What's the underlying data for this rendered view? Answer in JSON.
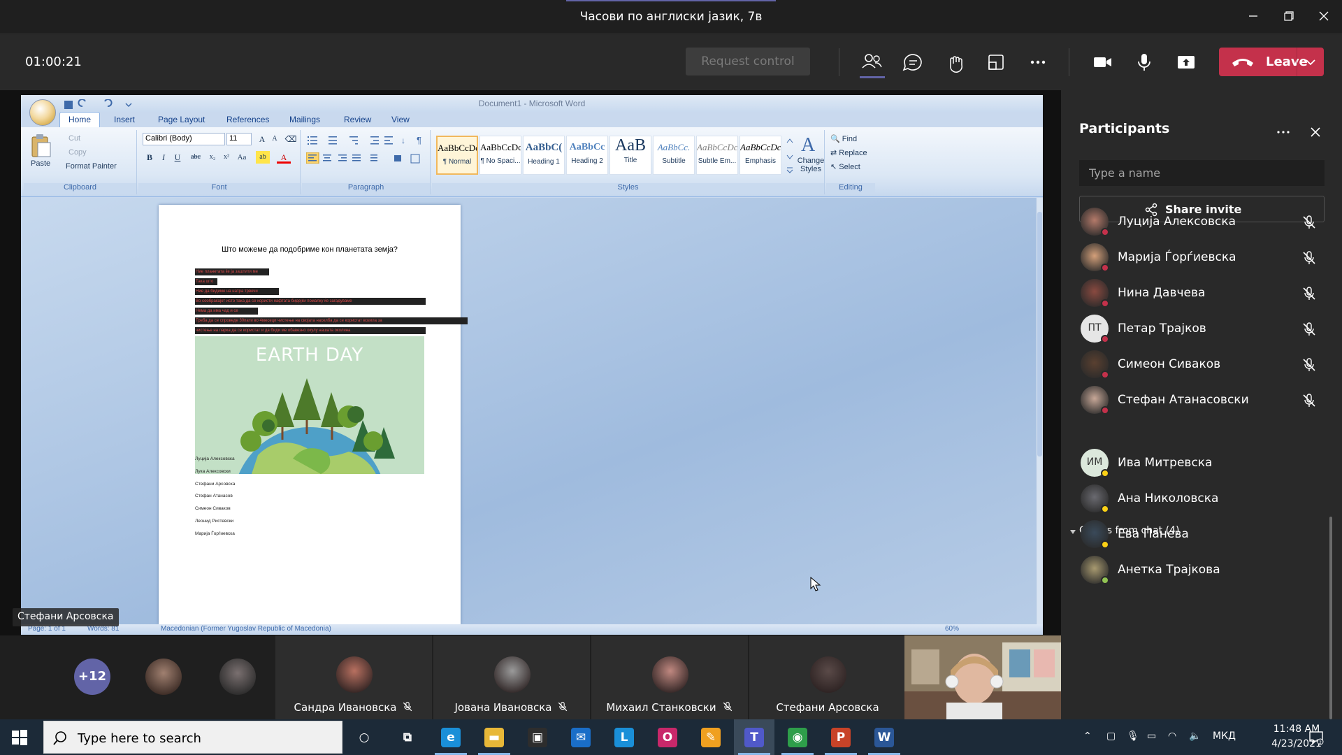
{
  "window": {
    "title": "Часови по англиски јазик, 7в"
  },
  "toolbar": {
    "timer": "01:00:21",
    "request_control_label": "Request control",
    "leave_label": "Leave"
  },
  "word": {
    "title": "Document1 - Microsoft Word",
    "tabs": [
      "Home",
      "Insert",
      "Page Layout",
      "References",
      "Mailings",
      "Review",
      "View"
    ],
    "clipboard": {
      "paste": "Paste",
      "cut": "Cut",
      "copy": "Copy",
      "format_painter": "Format Painter",
      "group": "Clipboard"
    },
    "font": {
      "name": "Calibri (Body)",
      "size": "11",
      "group": "Font"
    },
    "paragraph_group": "Paragraph",
    "styles": [
      {
        "sample": "AaBbCcDc",
        "name": "¶ Normal"
      },
      {
        "sample": "AaBbCcDc",
        "name": "¶ No Spaci..."
      },
      {
        "sample": "AaBbC(",
        "name": "Heading 1"
      },
      {
        "sample": "AaBbCc",
        "name": "Heading 2"
      },
      {
        "sample": "AaB",
        "name": "Title"
      },
      {
        "sample": "AaBbCc.",
        "name": "Subtitle"
      },
      {
        "sample": "AaBbCcDc",
        "name": "Subtle Em..."
      },
      {
        "sample": "AaBbCcDc",
        "name": "Emphasis"
      }
    ],
    "styles_group": "Styles",
    "change_styles": "Change Styles",
    "editing": {
      "find": "Find",
      "replace": "Replace",
      "select": "Select",
      "group": "Editing"
    },
    "document": {
      "heading": "Што можеме да подобриме кон планетата земја?",
      "highlighted_lines": [
        "Ние планетата ќе ја заштити ме",
        "Така што",
        "Ние да бидиме на натра трвечи",
        "Во сообраќајот исто така да се користи нафтата  бидејќи помалку ќе загадуваме",
        "Нема да има чад и се",
        "Треба да се спроведе 30пати во 4месеци  чистење на својата населба да се користат возила за",
        "чистење на парка да се користат и да биди ме обавезно окулу нашата околина"
      ],
      "image_title": "EARTH DAY",
      "names": [
        "Луција Алексовска",
        "Лука Алексовски",
        "Стефани Арсовска",
        "Стефан Атанасов",
        "Симеон Сиваков",
        "Леонид Ристевски",
        "Марија Ѓорѓиевска"
      ]
    },
    "status": {
      "page": "Page: 1 of 1",
      "words": "Words: 81",
      "language": "Macedonian (Former Yugoslav Republic of Macedonia)",
      "zoom": "60%"
    }
  },
  "presenter_label": "Стефани Арсовска",
  "panel": {
    "title": "Participants",
    "search_placeholder": "Type a name",
    "share_invite_label": "Share invite",
    "participants": [
      {
        "name": "Луција Алексовска",
        "initials": "",
        "muted": true,
        "color": "#b47a6a"
      },
      {
        "name": "Марија Ѓорѓиевска",
        "initials": "",
        "muted": true,
        "color": "#d4a07a"
      },
      {
        "name": "Нина Давчева",
        "initials": "",
        "muted": true,
        "color": "#8a4a40"
      },
      {
        "name": "Петар Трајков",
        "initials": "ПТ",
        "muted": true,
        "color": "#e6e6e6"
      },
      {
        "name": "Симеон Сиваков",
        "initials": "",
        "muted": true,
        "color": "#5a4030"
      },
      {
        "name": "Стефан Атанасовски",
        "initials": "",
        "muted": true,
        "color": "#c8a898"
      }
    ],
    "others_header": "Others from chat (4)",
    "others": [
      {
        "name": "Ива Митревска",
        "initials": "ИМ",
        "color": "#dce8dc"
      },
      {
        "name": "Ана Николовска",
        "initials": "",
        "color": "#6a6a70"
      },
      {
        "name": "Ева Панева",
        "initials": "",
        "color": "#3a4a5a"
      },
      {
        "name": "Анетка Трајкова",
        "initials": "",
        "color": "#a89a70"
      }
    ]
  },
  "strip": {
    "more_count": "+12",
    "tiles": [
      {
        "name": "Сандра Ивановска",
        "color": "#b87060"
      },
      {
        "name": "Јована Ивановска",
        "color": "#9a9a9a"
      },
      {
        "name": "Михаил Станковски",
        "color": "#c08880"
      },
      {
        "name": "Стефани Арсовска",
        "color": "#5a4a48"
      }
    ]
  },
  "taskbar": {
    "search_placeholder": "Type here to search",
    "apps": [
      {
        "name": "cortana",
        "glyph": "○",
        "color": "transparent"
      },
      {
        "name": "task-view",
        "glyph": "⧉",
        "color": "transparent"
      },
      {
        "name": "edge",
        "glyph": "e",
        "color": "#1a8fd8"
      },
      {
        "name": "file-explorer",
        "glyph": "▬",
        "color": "#e8b838"
      },
      {
        "name": "store",
        "glyph": "▣",
        "color": "#2d2d2d"
      },
      {
        "name": "mail",
        "glyph": "✉",
        "color": "#1a6ec8"
      },
      {
        "name": "lexicon",
        "glyph": "L",
        "color": "#1a8fd8"
      },
      {
        "name": "app-circle",
        "glyph": "O",
        "color": "#c8286a"
      },
      {
        "name": "sketch",
        "glyph": "✎",
        "color": "#f0a020"
      },
      {
        "name": "teams",
        "glyph": "T",
        "color": "#5059c9"
      },
      {
        "name": "chrome",
        "glyph": "◉",
        "color": "#2e9e4a"
      },
      {
        "name": "powerpoint",
        "glyph": "P",
        "color": "#c84328"
      },
      {
        "name": "word",
        "glyph": "W",
        "color": "#2b5797"
      }
    ],
    "language": "МКД",
    "time": "11:48 AM",
    "date": "4/23/2021"
  }
}
